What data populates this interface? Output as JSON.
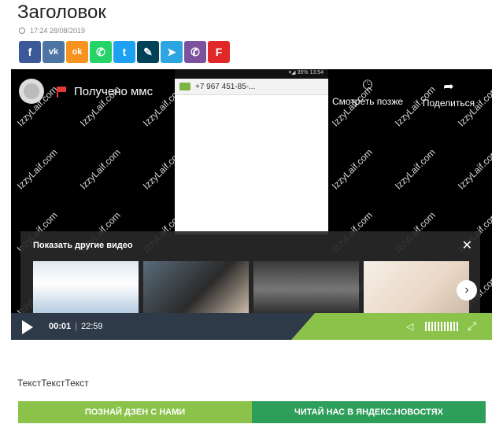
{
  "article": {
    "title": "Заголовок",
    "datetime": "17:24 28/08/2019",
    "body_text": "ТекстТекстТекст"
  },
  "share": [
    {
      "name": "facebook",
      "glyph": "f",
      "color": "#3b5998"
    },
    {
      "name": "vk",
      "glyph": "vk",
      "color": "#4c75a3"
    },
    {
      "name": "odnoklassniki",
      "glyph": "ok",
      "color": "#f7931e"
    },
    {
      "name": "whatsapp",
      "glyph": "✆",
      "color": "#25d366"
    },
    {
      "name": "twitter",
      "glyph": "t",
      "color": "#1da1f2"
    },
    {
      "name": "livejournal",
      "glyph": "✎",
      "color": "#004359"
    },
    {
      "name": "telegram",
      "glyph": "➤",
      "color": "#2ca5e0"
    },
    {
      "name": "viber",
      "glyph": "✆",
      "color": "#7c529e"
    },
    {
      "name": "flipboard",
      "glyph": "F",
      "color": "#e12828"
    }
  ],
  "video": {
    "title": "Получено ммс",
    "phone_number": "+7 967 451-85-...",
    "phone_status": "▾◢ 35% 13:54",
    "watch_later": "Смотреть позже",
    "share": "Поделиться",
    "watermark": "IzzyLaif.com",
    "more_videos": "Показать другие видео",
    "current_time": "00:01",
    "duration": "22:59",
    "colors": {
      "bar": "#2e3a48",
      "accent": "#8bc34a"
    }
  },
  "cta": {
    "zen": "ПОЗНАЙ ДЗЕН С НАМИ",
    "yandex": "ЧИТАЙ НАС В ЯНДЕКС.НОВОСТЯХ",
    "colors": {
      "zen": "#8bc34a",
      "yandex": "#2e9e5b"
    }
  }
}
